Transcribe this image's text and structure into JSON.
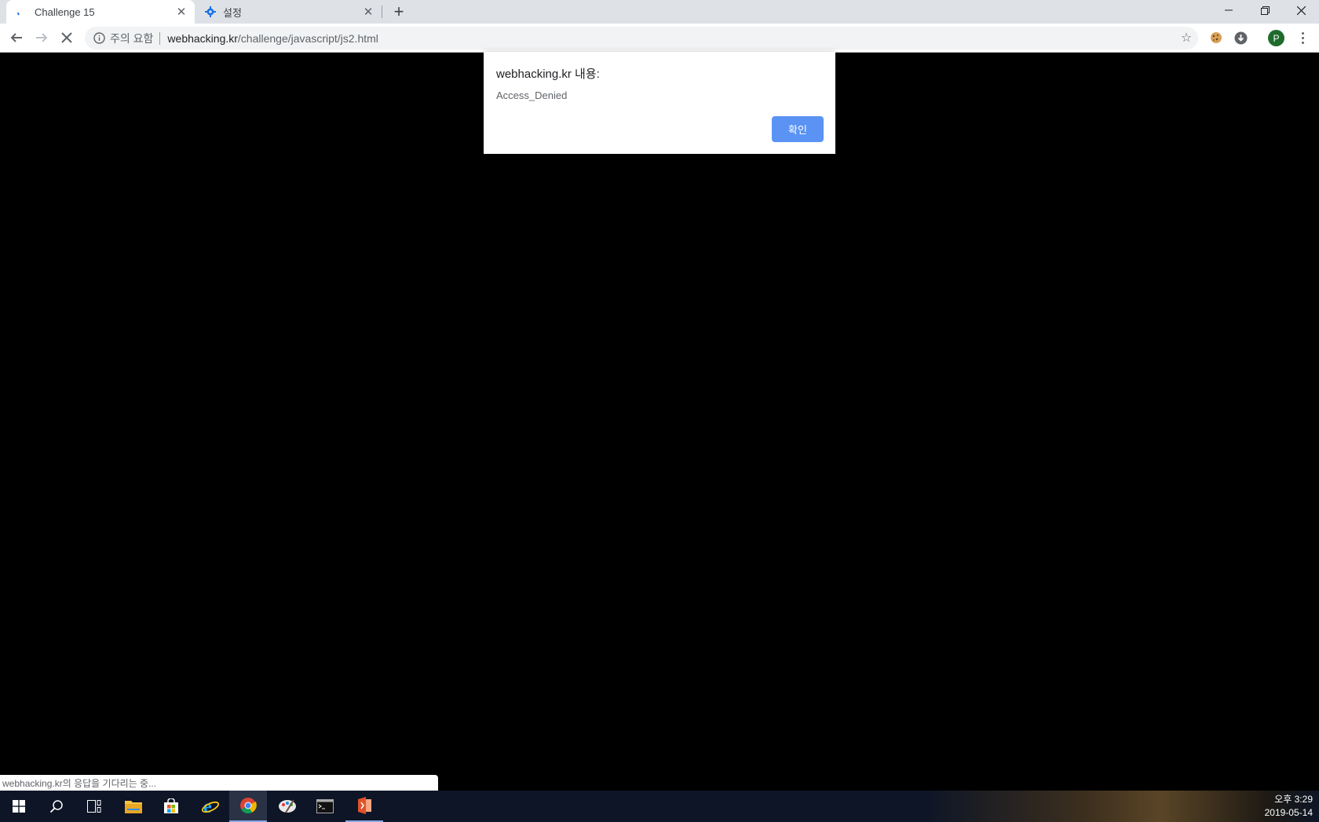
{
  "tabs": [
    {
      "title": "Challenge 15",
      "active": true,
      "icon": "loading-spinner-icon"
    },
    {
      "title": "설정",
      "active": false,
      "icon": "gear-icon"
    }
  ],
  "toolbar": {
    "security_label": "주의 요함",
    "url_host": "webhacking.kr",
    "url_path": "/challenge/javascript/js2.html",
    "profile_initial": "P"
  },
  "dialog": {
    "title": "webhacking.kr 내용:",
    "message": "Access_Denied",
    "ok_label": "확인"
  },
  "status_bar": {
    "text": "webhacking.kr의 응답을 기다리는 중..."
  },
  "taskbar": {
    "time": "오후 3:29",
    "date": "2019-05-14",
    "apps": [
      "start-icon",
      "search-icon",
      "task-view-icon",
      "file-explorer-icon",
      "store-icon",
      "internet-explorer-icon",
      "chrome-icon",
      "paint-icon",
      "terminal-icon",
      "office-icon"
    ]
  },
  "colors": {
    "dialog_button": "#5a93f4",
    "page_background": "#000000",
    "tabstrip": "#dee1e6"
  }
}
